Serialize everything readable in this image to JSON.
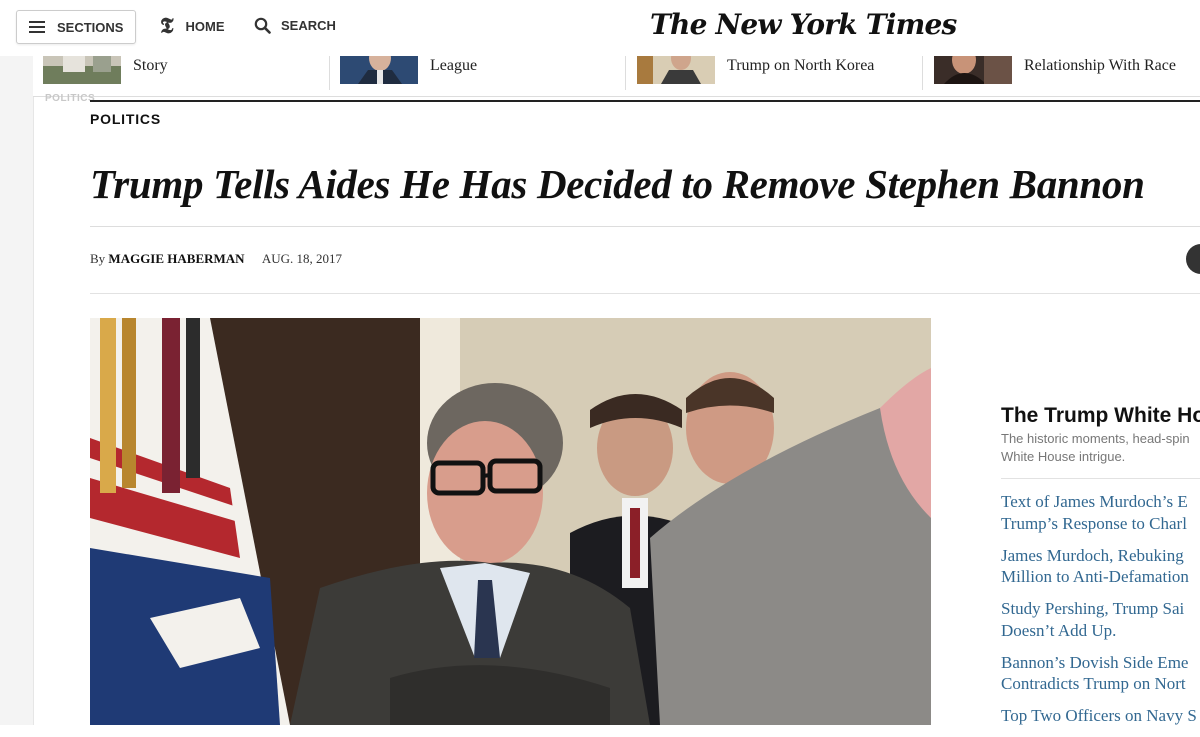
{
  "nav": {
    "sections_label": "SECTIONS",
    "home_label": "HOME",
    "home_logo": "𝕿",
    "search_label": "SEARCH",
    "masthead": "The New York Times"
  },
  "related": [
    {
      "text": "Revives a Bogus Pershing\nStory"
    },
    {
      "text": "to Anti-Defamation\nLeague"
    },
    {
      "text": "\nTrump on North Korea"
    },
    {
      "text": "\nRelationship With Race"
    }
  ],
  "section_ghost": "POLITICS",
  "article": {
    "kicker": "POLITICS",
    "headline": "Trump Tells Aides He Has Decided to Remove Stephen Bannon",
    "byline_prefix": "By",
    "author": "MAGGIE HABERMAN",
    "date": "AUG. 18, 2017"
  },
  "sidebar": {
    "title": "The Trump White Ho",
    "description": "The historic moments, head-spin\nWhite House intrigue.",
    "links": [
      "Text of James Murdoch’s E\nTrump’s Response to Charl",
      "James Murdoch, Rebuking\nMillion to Anti-Defamation",
      "Study Pershing, Trump Sai\nDoesn’t Add Up.",
      "Bannon’s Dovish Side Eme\nContradicts Trump on Nort",
      "Top Two Officers on Navy S"
    ]
  },
  "colors": {
    "link": "#326891",
    "text": "#111111",
    "muted": "#777777"
  }
}
